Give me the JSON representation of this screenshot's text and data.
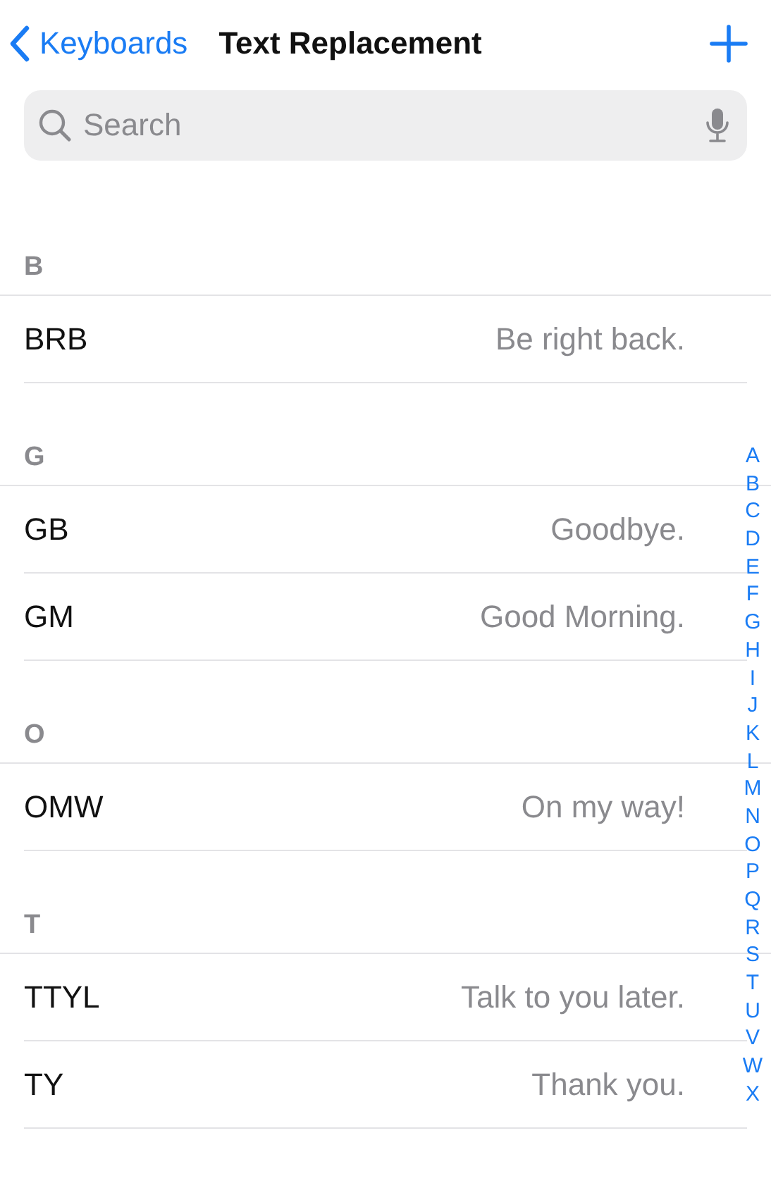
{
  "nav": {
    "back": "Keyboards",
    "title": "Text Replacement"
  },
  "search": {
    "placeholder": "Search"
  },
  "sections": [
    {
      "header": "B",
      "rows": [
        {
          "shortcut": "BRB",
          "phrase": "Be right back."
        }
      ]
    },
    {
      "header": "G",
      "rows": [
        {
          "shortcut": "GB",
          "phrase": "Goodbye."
        },
        {
          "shortcut": "GM",
          "phrase": "Good Morning."
        }
      ]
    },
    {
      "header": "O",
      "rows": [
        {
          "shortcut": "OMW",
          "phrase": "On my way!"
        }
      ]
    },
    {
      "header": "T",
      "rows": [
        {
          "shortcut": "TTYL",
          "phrase": "Talk to you later."
        },
        {
          "shortcut": "TY",
          "phrase": "Thank you."
        }
      ]
    }
  ],
  "index": [
    "A",
    "B",
    "C",
    "D",
    "E",
    "F",
    "G",
    "H",
    "I",
    "J",
    "K",
    "L",
    "M",
    "N",
    "O",
    "P",
    "Q",
    "R",
    "S",
    "T",
    "U",
    "V",
    "W",
    "X"
  ]
}
